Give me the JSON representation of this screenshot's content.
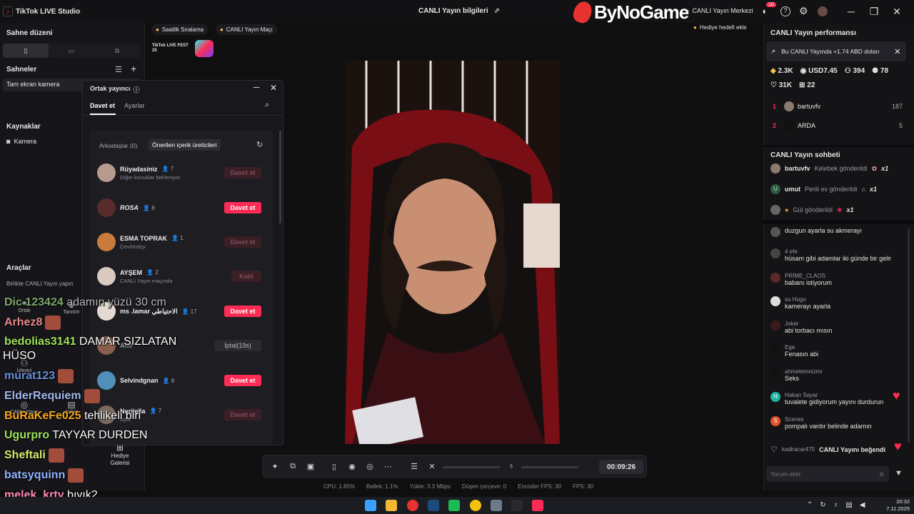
{
  "app": {
    "title": "TikTok LIVE Studio"
  },
  "header": {
    "center_title": "CANLI Yayın bilgileri",
    "watermark": "ByNoGame",
    "live_center": "CANLI Yayın Merkezi",
    "notif_count": "10"
  },
  "left": {
    "scene_layout_title": "Sahne düzeni",
    "scenes_title": "Sahneler",
    "scene_item": "Tam ekran kamera",
    "sources_title": "Kaynaklar",
    "source_camera": "Kamera",
    "tools_title": "Araçlar",
    "tools_sub": "Birlikte CANLI Yayın yapın",
    "tool_labels": [
      "Ortak",
      "Tanıtım",
      "İzleyici",
      "CANLI Yayın",
      "Anket",
      "Hediye Galerisi"
    ]
  },
  "top_chips": {
    "chip1": "Saatlik Sıralama",
    "chip2": "CANLI Yayın Maçı",
    "fest": "TikTok LIVE FEST 25",
    "gift_goal": "Hediye hedefi ekle"
  },
  "modal": {
    "title": "Ortak yayıncı",
    "tab_invite": "Davet et",
    "tab_settings": "Ayarlar",
    "sub_friends": "Arkadaşlar (0)",
    "sub_suggested": "Önerilen içerik üreticileri",
    "rows": [
      {
        "name": "Rüyadasiniz",
        "count": "7",
        "sub": "Diğer konuklar bekleniyor",
        "btn": "Davet et",
        "state": "off"
      },
      {
        "name": "ROSA",
        "count": "8",
        "sub": "",
        "btn": "Davet et",
        "state": "on"
      },
      {
        "name": "ESMA TOPRAK",
        "count": "1",
        "sub": "Çevrimdışı",
        "btn": "Davet et",
        "state": "off"
      },
      {
        "name": "AYŞEM",
        "count": "2",
        "sub": "CANLI Yayın maçında",
        "btn": "Katıl",
        "state": "off"
      },
      {
        "name": "ms .lamar الاحتياطي",
        "count": "17",
        "sub": "",
        "btn": "Davet et",
        "state": "on"
      },
      {
        "name": "Anıl",
        "count": "",
        "sub": "",
        "btn": "İptal(19s)",
        "state": "grey"
      },
      {
        "name": "Selvindgnan",
        "count": "8",
        "sub": "",
        "btn": "Davet et",
        "state": "on"
      },
      {
        "name": "Nurijella",
        "count": "7",
        "sub": "aşlar",
        "btn": "Davet et",
        "state": "off"
      }
    ]
  },
  "overlay_chat": [
    {
      "user": "Dic 123424",
      "msg": "adamın yüzü 30 cm",
      "color": "#7fa76b"
    },
    {
      "user": "Arhez8",
      "msg": "",
      "color": "#e98a8a"
    },
    {
      "user": "bedolias3141",
      "msg": "DAMAR SIZLATAN",
      "color": "#9fe35a"
    },
    {
      "user": "",
      "msg": "HÜSO",
      "color": "#ffffff"
    },
    {
      "user": "murat123",
      "msg": "",
      "color": "#6a8fd6"
    },
    {
      "user": "ElderRequiem",
      "msg": "",
      "color": "#a4b7f0"
    },
    {
      "user": "BuRaKeFe025",
      "msg": "tehlikeli biri",
      "color": "#f5a623"
    },
    {
      "user": "Ugurpro",
      "msg": "TAYYAR DURDEN",
      "color": "#9fe35a"
    },
    {
      "user": "Sheftali",
      "msg": "",
      "color": "#d7e96c"
    },
    {
      "user": "batsyquinn",
      "msg": "",
      "color": "#8fb4ff"
    },
    {
      "user": "melek_krty",
      "msg": "bıyık2",
      "color": "#ff8ab4"
    }
  ],
  "performance": {
    "title": "CANLI Yayın performansı",
    "earnings_msg": "Bu CANLI Yayında +1.74 ABD doları",
    "diamonds": "2.3K",
    "usd": "USD7.45",
    "viewers": "394",
    "followers": "78",
    "likes": "31K",
    "gifts": "22",
    "top": [
      {
        "rank": "1",
        "name": "bartuvfv",
        "value": "187"
      },
      {
        "rank": "2",
        "name": "ARDA",
        "value": "5"
      }
    ]
  },
  "chat": {
    "title": "CANLI Yayın sohbeti",
    "gifts": [
      {
        "user": "bartuvfv",
        "text": "Kelebek gönderildi",
        "mult": "x1"
      },
      {
        "user": "umut",
        "text": "Perili ev gönderildi",
        "mult": "x1"
      },
      {
        "user": "",
        "text": "Gül gönderildi",
        "mult": "x1"
      }
    ],
    "messages": [
      {
        "user": "",
        "text": "duzgun ayarla su akmerayı"
      },
      {
        "user": "4 efe",
        "text": "hüsam gibi adamlar iki günde bir gelir"
      },
      {
        "user": "PRİME_CLAOS",
        "text": "babanı istiyorum"
      },
      {
        "user": "su Hugo",
        "text": "kamerayı ayarla"
      },
      {
        "user": "Joker",
        "text": "abi torbacı mısın"
      },
      {
        "user": "Ege",
        "text": "Fenasın abi"
      },
      {
        "user": "ahmetemnizmr",
        "text": "Seks"
      },
      {
        "user": "Hakan Sayar",
        "text": "tuvalete gidiyorum yayını durdurun"
      },
      {
        "user": "Scenes",
        "text": "pompalı vardır belinde adamın"
      }
    ],
    "like_line": {
      "user": "kadiracar475",
      "text": "CANLI Yayını beğendi"
    },
    "input_placeholder": "Yorum ekle"
  },
  "controls": {
    "timer": "00:09:26"
  },
  "stats": {
    "cpu": "CPU: 1.85%",
    "memory": "Bellek: 1.1%",
    "upload": "Yükle: 3.3 Mbps",
    "dropped": "Düşen çerçeve: 0",
    "encoder_fps": "Encoder FPS: 30",
    "fps": "FPS: 30"
  },
  "taskbar": {
    "time": "20:32",
    "date": "7.11.2025"
  }
}
